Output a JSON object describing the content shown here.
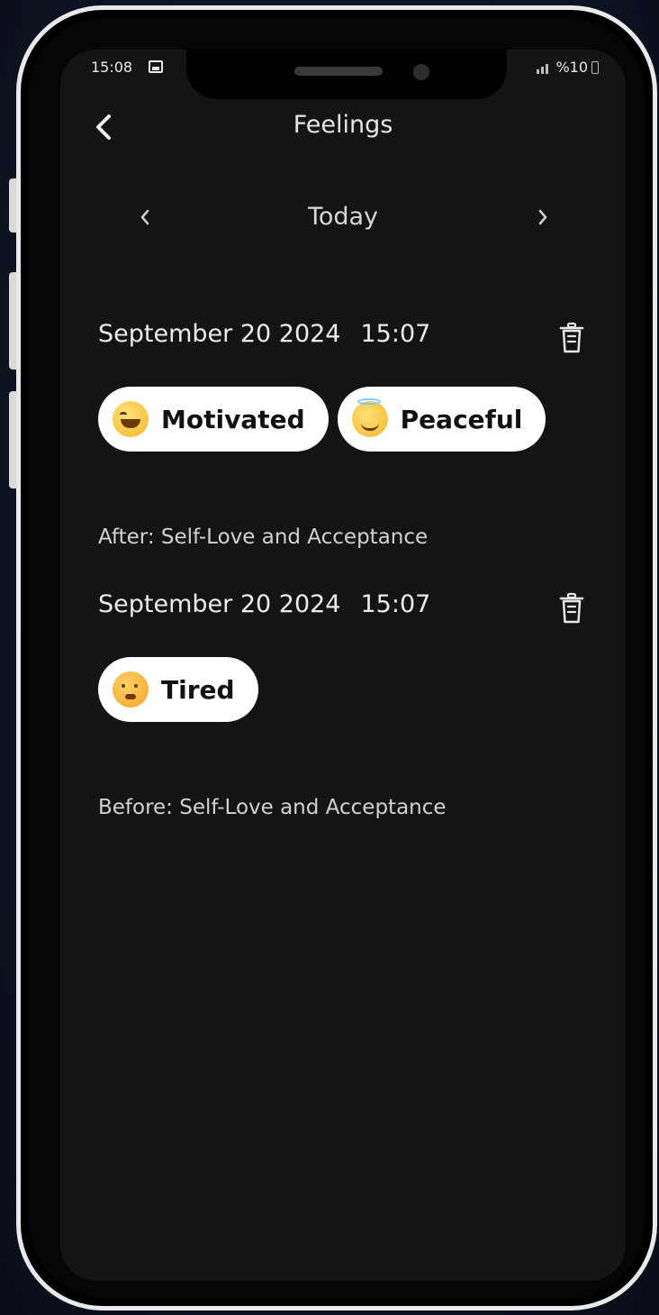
{
  "status_bar": {
    "time": "15:08",
    "battery": "%10"
  },
  "header": {
    "title": "Feelings",
    "back_icon": "chevron-left-icon"
  },
  "date_nav": {
    "label": "Today",
    "prev_icon": "chevron-left-icon",
    "next_icon": "chevron-right-icon"
  },
  "entries": [
    {
      "date": "September 20 2024",
      "time": "15:07",
      "tags": [
        {
          "label": "Motivated",
          "icon": "laughing-face-icon"
        },
        {
          "label": "Peaceful",
          "icon": "angel-face-icon"
        }
      ],
      "note": "After: Self-Love and Acceptance"
    },
    {
      "date": "September 20 2024",
      "time": "15:07",
      "tags": [
        {
          "label": "Tired",
          "icon": "tired-face-icon"
        }
      ],
      "note": "Before: Self-Love and Acceptance"
    }
  ],
  "colors": {
    "screen_bg": "#141414",
    "tag_bg": "#ffffff",
    "text_primary": "#ececec"
  }
}
